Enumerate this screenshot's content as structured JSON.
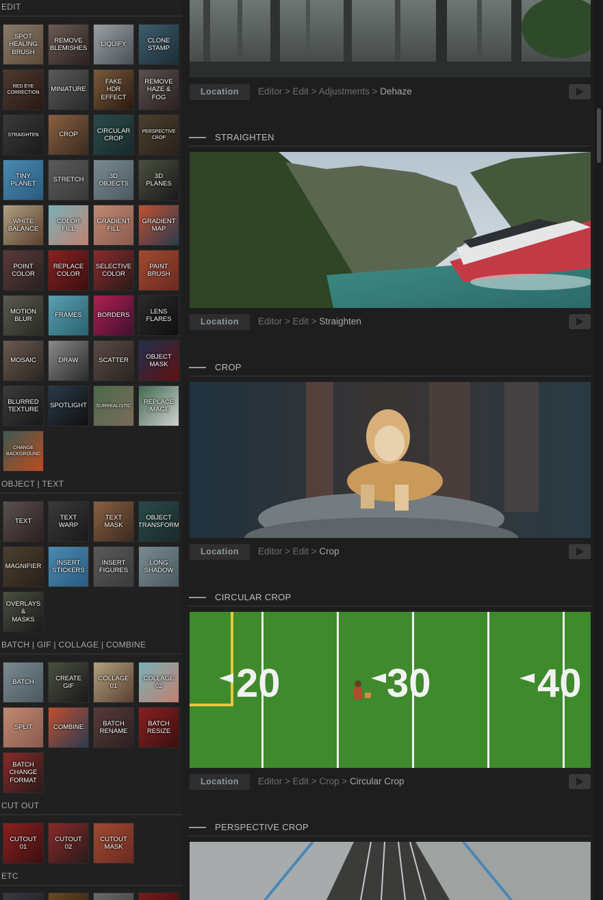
{
  "sidebar": {
    "sections": [
      {
        "title": "EDIT",
        "tiles": [
          {
            "label": "SPOT\nHEALING\nBRUSH",
            "icon": "spot-healing-brush-icon"
          },
          {
            "label": "REMOVE\nBLEMISHES",
            "icon": "remove-blemishes-icon"
          },
          {
            "label": "LIQUIFY",
            "icon": "liquify-icon"
          },
          {
            "label": "CLONE\nSTAMP",
            "icon": "clone-stamp-icon"
          },
          {
            "label": "RED EYE\nCORRECTION",
            "icon": "red-eye-correction-icon",
            "small": true
          },
          {
            "label": "MINIATURE",
            "icon": "miniature-icon"
          },
          {
            "label": "FAKE\nHDR EFFECT",
            "icon": "fake-hdr-effect-icon"
          },
          {
            "label": "REMOVE\nHAZE & FOG",
            "icon": "remove-haze-fog-icon"
          },
          {
            "label": "STRAIGHTEN",
            "icon": "straighten-icon",
            "small": true
          },
          {
            "label": "CROP",
            "icon": "crop-icon"
          },
          {
            "label": "CIRCULAR\nCROP",
            "icon": "circular-crop-icon"
          },
          {
            "label": "PERSPECTIVE\nCROP",
            "icon": "perspective-crop-icon",
            "small": true
          },
          {
            "label": "TINY\nPLANET",
            "icon": "tiny-planet-icon"
          },
          {
            "label": "STRETCH",
            "icon": "stretch-icon"
          },
          {
            "label": "3D\nOBJECTS",
            "icon": "3d-objects-icon"
          },
          {
            "label": "3D\nPLANES",
            "icon": "3d-planes-icon"
          },
          {
            "label": "WHITE\nBALANCE",
            "icon": "white-balance-icon"
          },
          {
            "label": "COLOR\nFILL",
            "icon": "color-fill-icon"
          },
          {
            "label": "GRADIENT\nFILL",
            "icon": "gradient-fill-icon"
          },
          {
            "label": "GRADIENT\nMAP",
            "icon": "gradient-map-icon"
          },
          {
            "label": "POINT\nCOLOR",
            "icon": "point-color-icon"
          },
          {
            "label": "REPLACE\nCOLOR",
            "icon": "replace-color-icon"
          },
          {
            "label": "SELECTIVE\nCOLOR",
            "icon": "selective-color-icon"
          },
          {
            "label": "PAINT\nBRUSH",
            "icon": "paint-brush-icon"
          },
          {
            "label": "MOTION\nBLUR",
            "icon": "motion-blur-icon"
          },
          {
            "label": "FRAMES",
            "icon": "frames-icon"
          },
          {
            "label": "BORDERS",
            "icon": "borders-icon"
          },
          {
            "label": "LENS\nFLARES",
            "icon": "lens-flares-icon"
          },
          {
            "label": "MOSAIC",
            "icon": "mosaic-icon"
          },
          {
            "label": "DRAW",
            "icon": "draw-icon"
          },
          {
            "label": "SCATTER",
            "icon": "scatter-icon"
          },
          {
            "label": "OBJECT\nMASK",
            "icon": "object-mask-icon"
          },
          {
            "label": "BLURRED\nTEXTURE",
            "icon": "blurred-texture-icon"
          },
          {
            "label": "SPOTLIGHT",
            "icon": "spotlight-icon"
          },
          {
            "label": "SURREALISTIC",
            "icon": "surrealistic-icon",
            "small": true
          },
          {
            "label": "REPLACE\nIMAGE",
            "icon": "replace-image-icon"
          },
          {
            "label": "CHANGE\nBACKGROUND",
            "icon": "change-background-icon",
            "small": true
          }
        ]
      },
      {
        "title": "OBJECT | TEXT",
        "tiles": [
          {
            "label": "TEXT",
            "icon": "text-icon"
          },
          {
            "label": "TEXT\nWARP",
            "icon": "text-warp-icon"
          },
          {
            "label": "TEXT\nMASK",
            "icon": "text-mask-icon"
          },
          {
            "label": "OBJECT\nTRANSFORM",
            "icon": "object-transform-icon"
          },
          {
            "label": "MAGNIFIER",
            "icon": "magnifier-icon"
          },
          {
            "label": "INSERT\nSTICKERS",
            "icon": "insert-stickers-icon"
          },
          {
            "label": "INSERT\nFIGURES",
            "icon": "insert-figures-icon"
          },
          {
            "label": "LONG\nSHADOW",
            "icon": "long-shadow-icon"
          },
          {
            "label": "OVERLAYS\n&\nMASKS",
            "icon": "overlays-masks-icon"
          }
        ]
      },
      {
        "title": "BATCH | GIF | COLLAGE | COMBINE",
        "tiles": [
          {
            "label": "BATCH",
            "icon": "batch-icon"
          },
          {
            "label": "CREATE\nGIF",
            "icon": "create-gif-icon"
          },
          {
            "label": "COLLAGE\n01",
            "icon": "collage-01-icon"
          },
          {
            "label": "COLLAGE\n02",
            "icon": "collage-02-icon"
          },
          {
            "label": "SPLIT",
            "icon": "split-icon"
          },
          {
            "label": "COMBINE",
            "icon": "combine-icon"
          },
          {
            "label": "BATCH\nRENAME",
            "icon": "batch-rename-icon"
          },
          {
            "label": "BATCH\nRESIZE",
            "icon": "batch-resize-icon"
          },
          {
            "label": "BATCH\nCHANGE\nFORMAT",
            "icon": "batch-change-format-icon"
          }
        ]
      },
      {
        "title": "CUT OUT",
        "tiles": [
          {
            "label": "CUTOUT\n01",
            "icon": "cutout-01-icon"
          },
          {
            "label": "CUTOUT\n02",
            "icon": "cutout-02-icon"
          },
          {
            "label": "CUTOUT\nMASK",
            "icon": "cutout-mask-icon"
          }
        ]
      },
      {
        "title": "ETC",
        "tiles": []
      }
    ]
  },
  "main": {
    "location_label": "Location",
    "top_entry": {
      "image": "dehaze-forest-image",
      "breadcrumb": [
        "Editor",
        "Edit",
        "Adjustments"
      ],
      "current": "Dehaze"
    },
    "tools": [
      {
        "name": "STRAIGHTEN",
        "image": "straighten-boat-image",
        "breadcrumb": [
          "Editor",
          "Edit"
        ],
        "current": "Straighten"
      },
      {
        "name": "CROP",
        "image": "crop-lioness-image",
        "breadcrumb": [
          "Editor",
          "Edit"
        ],
        "current": "Crop"
      },
      {
        "name": "CIRCULAR CROP",
        "image": "circular-crop-field-image",
        "breadcrumb": [
          "Editor",
          "Edit",
          "Crop"
        ],
        "current": "Circular Crop"
      },
      {
        "name": "PERSPECTIVE CROP",
        "image": "perspective-crop-rails-image",
        "breadcrumb": [],
        "current": ""
      }
    ],
    "field_numbers": [
      "20",
      "30",
      "40"
    ]
  },
  "colors": {
    "background": "#1e1e1e",
    "sidebar": "#202020",
    "location_button": "#2f2f2f",
    "field_green": "#3f8a2d"
  }
}
